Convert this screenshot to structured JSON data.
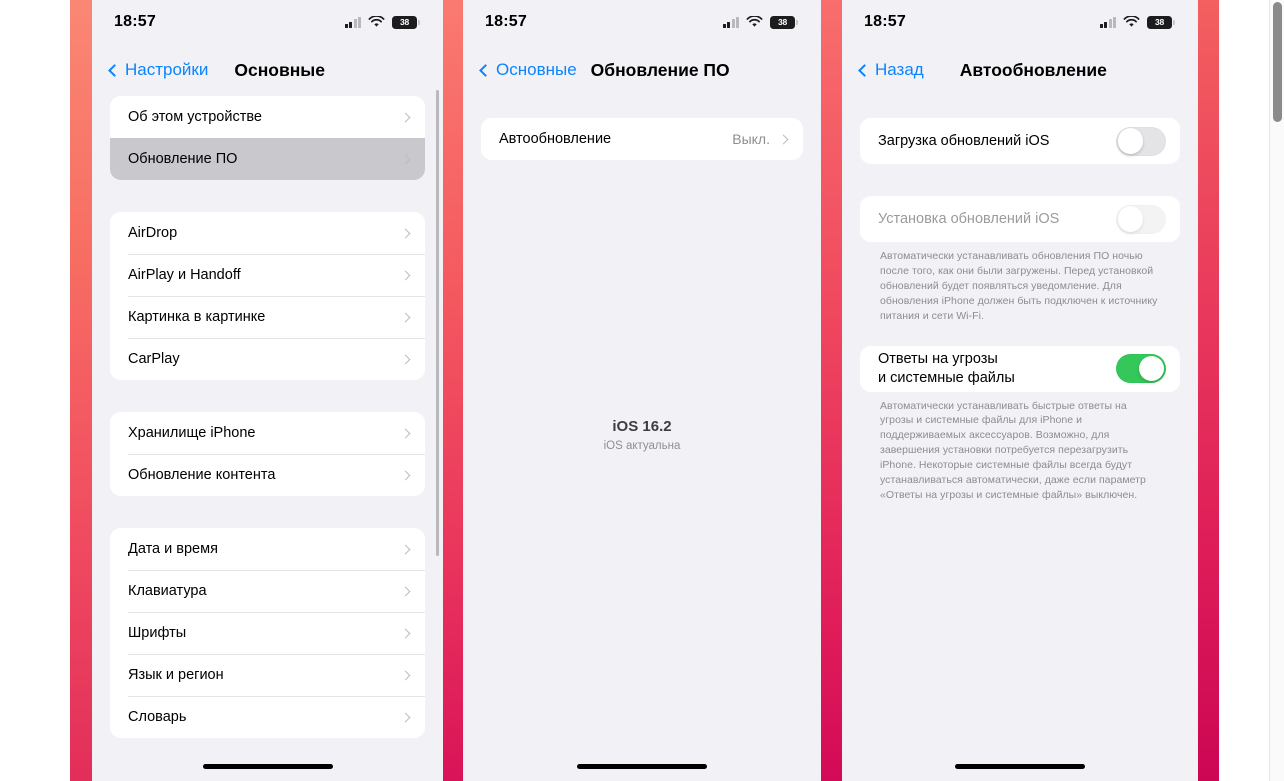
{
  "statusbar": {
    "time": "18:57",
    "battery_level": "38",
    "signal_icon": "cellular-signal-icon",
    "wifi_icon": "wifi-icon",
    "battery_icon": "battery-icon"
  },
  "screen1": {
    "back_label": "Настройки",
    "title": "Основные",
    "groups": [
      {
        "rows": [
          {
            "label": "Об этом устройстве",
            "selected": false
          },
          {
            "label": "Обновление ПО",
            "selected": true
          }
        ]
      },
      {
        "rows": [
          {
            "label": "AirDrop",
            "selected": false
          },
          {
            "label": "AirPlay и Handoff",
            "selected": false
          },
          {
            "label": "Картинка в картинке",
            "selected": false
          },
          {
            "label": "CarPlay",
            "selected": false
          }
        ]
      },
      {
        "rows": [
          {
            "label": "Хранилище iPhone",
            "selected": false
          },
          {
            "label": "Обновление контента",
            "selected": false
          }
        ]
      },
      {
        "rows": [
          {
            "label": "Дата и время",
            "selected": false
          },
          {
            "label": "Клавиатура",
            "selected": false
          },
          {
            "label": "Шрифты",
            "selected": false
          },
          {
            "label": "Язык и регион",
            "selected": false
          },
          {
            "label": "Словарь",
            "selected": false
          }
        ]
      }
    ]
  },
  "screen2": {
    "back_label": "Основные",
    "title": "Обновление ПО",
    "row": {
      "label": "Автообновление",
      "value": "Выкл."
    },
    "version": {
      "name": "iOS 16.2",
      "status": "iOS актуальна"
    }
  },
  "screen3": {
    "back_label": "Назад",
    "title": "Автообновление",
    "toggle_download": {
      "label": "Загрузка обновлений iOS",
      "state": "off",
      "disabled": false
    },
    "toggle_install": {
      "label": "Установка обновлений iOS",
      "state": "off",
      "disabled": true
    },
    "install_footnote": "Автоматически устанавливать обновления ПО ночью после того, как они были загружены. Перед установкой обновлений будет появляться уведомление. Для обновления iPhone должен быть подключен к источнику питания и сети Wi-Fi.",
    "toggle_security": {
      "label_line1": "Ответы на угрозы",
      "label_line2": "и системные файлы",
      "state": "on",
      "disabled": false
    },
    "security_footnote": "Автоматически устанавливать быстрые ответы на угрозы и системные файлы для iPhone и поддерживаемых аксессуаров. Возможно, для завершения установки потребуется перезагрузить iPhone. Некоторые системные файлы всегда будут устанавливаться автоматически, даже если параметр «Ответы на угрозы и системные файлы» выключен."
  },
  "colors": {
    "accent_blue": "#0a84ff",
    "toggle_on_green": "#34c759",
    "screen_bg": "#f2f1f6",
    "divider_gradient_start": "#fa8173",
    "divider_gradient_end": "#d81e5b",
    "selected_row": "#c9c8cd"
  }
}
